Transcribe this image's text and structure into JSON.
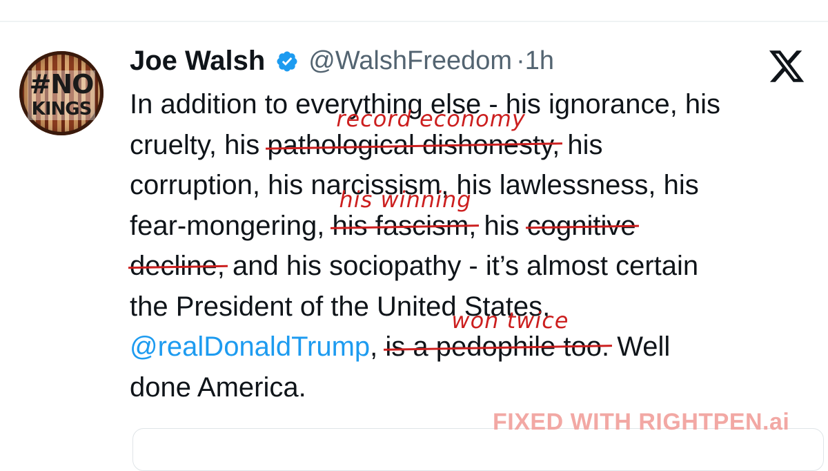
{
  "author": {
    "name": "Joe Walsh",
    "handle": "@WalshFreedom",
    "separator": "·",
    "time": "1h",
    "avatar_text_line1": "#NO",
    "avatar_text_line2": "KINGS"
  },
  "icons": {
    "verified": "verified-badge-icon",
    "logo": "x-logo-icon"
  },
  "colors": {
    "mention": "#1d9bf0",
    "edit_red": "#cc1f1f",
    "watermark": "#f2a8a4"
  },
  "tweet": {
    "l1": "In addition to everything else - his ignorance, his",
    "l2_a": "cruelty, his ",
    "l2_struck": "pathological dishonesty,",
    "l2_b": " his",
    "l3": "corruption, his narcissism, his lawlessness, his",
    "l4_a": "fear-mongering, ",
    "l4_struck": "his fascism,",
    "l4_b": " his ",
    "l4_struck2": "cognitive",
    "l5_struck": "decline,",
    "l5_b": " and his sociopathy - it’s almost certain",
    "l6": "the President of the United States,",
    "l7_mention": "@realDonaldTrump",
    "l7_a": ", ",
    "l7_struck": "is a pedophile too.",
    "l7_b": " Well",
    "l8": "done America."
  },
  "edits": {
    "edit1": "record economy",
    "edit2": "his winning",
    "edit3": "won twice"
  },
  "watermark": "FIXED WITH RIGHTPEN.ai"
}
